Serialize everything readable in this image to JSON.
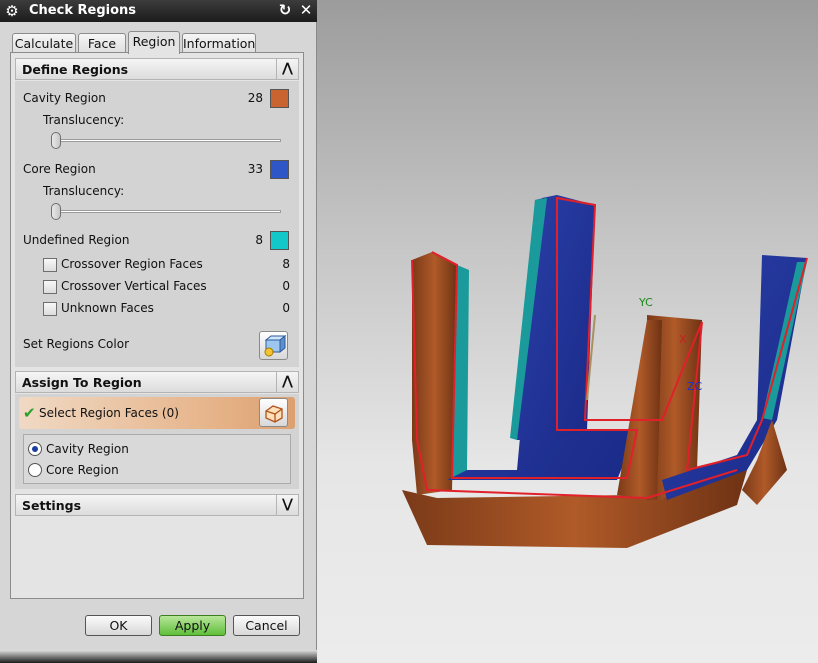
{
  "dialog": {
    "title": "Check Regions",
    "icons": {
      "menu": "gear-icon",
      "reset": "reset-icon",
      "close": "close-icon"
    },
    "tabs": [
      {
        "label": "Calculate"
      },
      {
        "label": "Face"
      },
      {
        "label": "Region",
        "active": true
      },
      {
        "label": "Information"
      }
    ],
    "define_regions": {
      "header": "Define Regions",
      "cavity": {
        "label": "Cavity Region",
        "count": "28",
        "color": "#c9632f"
      },
      "translucency_label": "Translucency:",
      "cavity_translucency": 0,
      "core": {
        "label": "Core Region",
        "count": "33",
        "color": "#2f56c6"
      },
      "core_translucency": 0,
      "undefined": {
        "label": "Undefined Region",
        "count": "8",
        "color": "#12c8c8"
      },
      "options": [
        {
          "label": "Crossover Region Faces",
          "count": "8",
          "checked": false
        },
        {
          "label": "Crossover Vertical Faces",
          "count": "0",
          "checked": false
        },
        {
          "label": "Unknown Faces",
          "count": "0",
          "checked": false
        }
      ],
      "set_color_label": "Set Regions Color"
    },
    "assign": {
      "header": "Assign To Region",
      "select_label": "Select Region Faces (0)",
      "radios": [
        {
          "label": "Cavity Region",
          "selected": true
        },
        {
          "label": "Core Region",
          "selected": false
        }
      ]
    },
    "settings": {
      "header": "Settings"
    },
    "buttons": {
      "ok": "OK",
      "apply": "Apply",
      "cancel": "Cancel"
    }
  },
  "viewport": {
    "axes": {
      "y": "YC",
      "x": "X",
      "z": "ZC"
    }
  }
}
